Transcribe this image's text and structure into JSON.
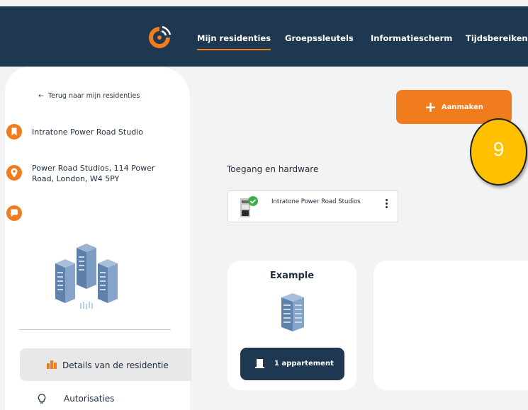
{
  "nav": {
    "items": [
      {
        "label": "Mijn residenties",
        "active": true
      },
      {
        "label": "Groepssleutels"
      },
      {
        "label": "Informatiescherm"
      },
      {
        "label": "Tijdsbereiken"
      }
    ]
  },
  "sidebar": {
    "back_label": "Terug naar mijn residenties",
    "residence_name": "Intratone Power Road Studio",
    "address": "Power Road Studios, 114 Power Road, London, W4 5PY",
    "menu": {
      "details_label": "Details van de residentie",
      "authorizations_label": "Autorisaties"
    }
  },
  "main": {
    "create_label": "Aanmaken",
    "badge_number": "9",
    "section_title": "Toegang en hardware",
    "device": {
      "name": "Intratone Power Road Studios"
    },
    "building": {
      "name": "Example",
      "apartments_label": "1 appartement"
    }
  },
  "colors": {
    "navy": "#1d3850",
    "orange": "#f07c1d",
    "badge": "#ffc000",
    "check_green": "#3fae49"
  }
}
